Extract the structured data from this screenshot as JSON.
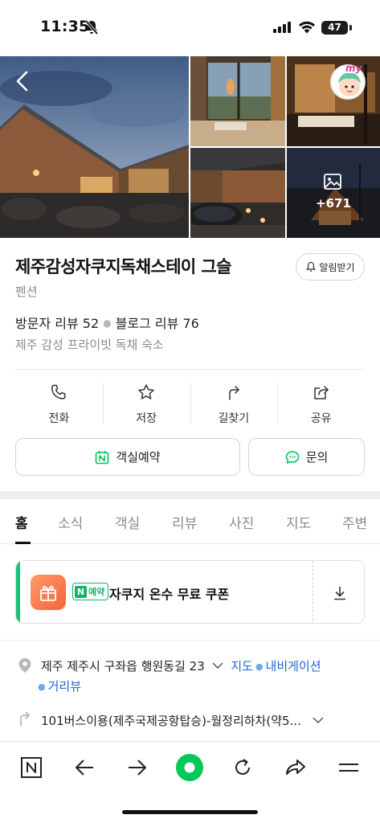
{
  "status_bar": {
    "time": "11:35",
    "battery": "47"
  },
  "gallery": {
    "more_photos_count": "+671",
    "avatar_badge": "my"
  },
  "place": {
    "title": "제주감성자쿠지독채스테이 그슬",
    "category": "펜션",
    "visitor_reviews": "방문자 리뷰 52",
    "blog_reviews": "블로그 리뷰 76",
    "description": "제주 감성 프라이빗 독채 숙소",
    "notify_label": "알림받기"
  },
  "actions": [
    {
      "label": "전화",
      "icon": "phone-icon"
    },
    {
      "label": "저장",
      "icon": "star-icon"
    },
    {
      "label": "길찾기",
      "icon": "directions-icon"
    },
    {
      "label": "공유",
      "icon": "share-icon"
    }
  ],
  "buttons": {
    "reserve": "객실예약",
    "inquiry": "문의"
  },
  "tabs": [
    "홈",
    "소식",
    "객실",
    "리뷰",
    "사진",
    "지도",
    "주변"
  ],
  "coupon": {
    "badge": "예약",
    "text": "자쿠지 온수 무료 쿠폰"
  },
  "address": {
    "text": "제주 제주시 구좌읍 행원동길 23",
    "map_link": "지도",
    "navigation_link": "내비게이션",
    "street_view_link": "거리뷰"
  },
  "transit": {
    "text": "101버스이용(제주국제공항탑승)-월정리하차(약5..."
  },
  "colors": {
    "naver_green": "#03c75a",
    "link_blue": "#2266d4",
    "coupon_accent": "#19c37d"
  }
}
